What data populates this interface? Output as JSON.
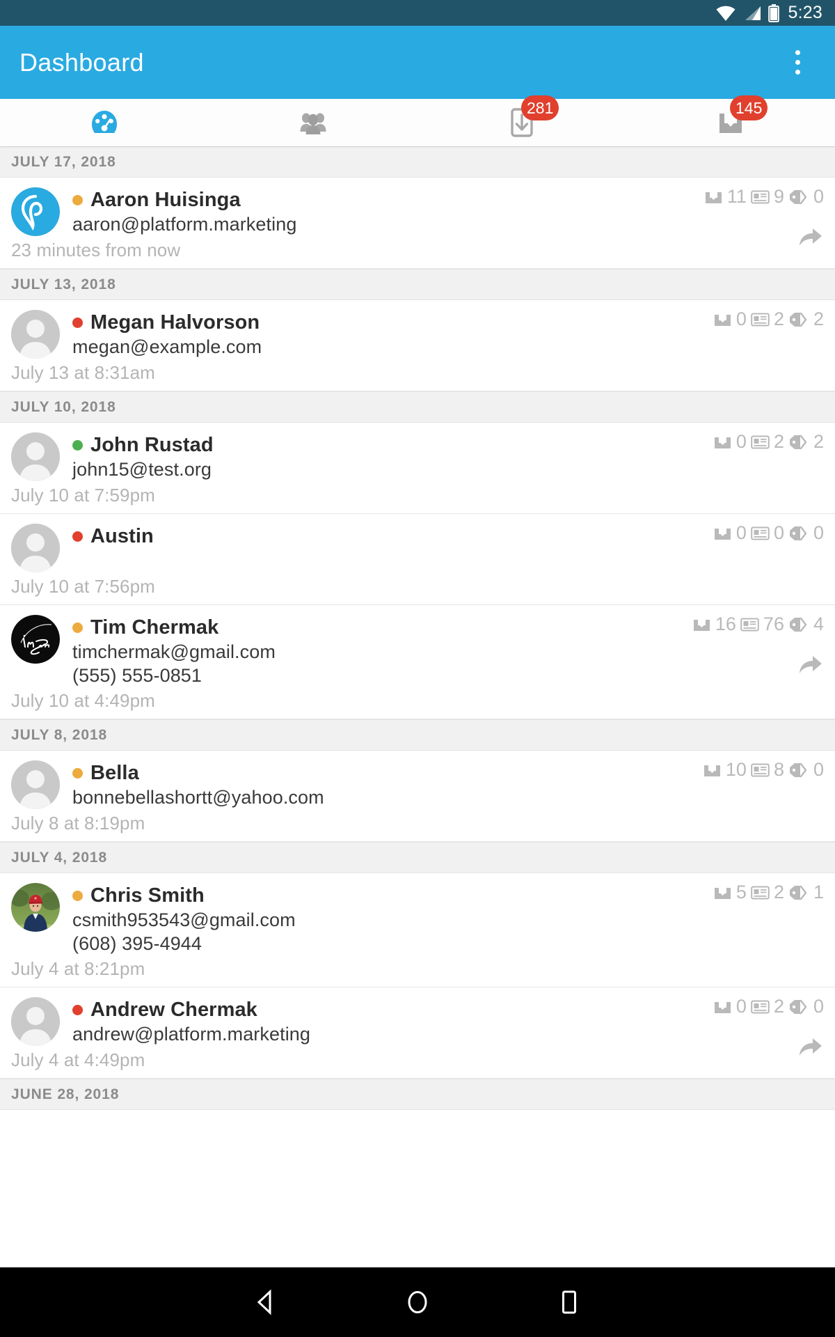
{
  "status_bar": {
    "time": "5:23",
    "icons": [
      "wifi-icon",
      "cell-signal-icon",
      "battery-icon"
    ]
  },
  "app_bar": {
    "title": "Dashboard",
    "overflow_label": "More options",
    "background": "#29aae1"
  },
  "tabs": [
    {
      "name": "dashboard",
      "icon": "speedometer-icon",
      "active": true,
      "badge": ""
    },
    {
      "name": "contacts",
      "icon": "people-icon",
      "active": false,
      "badge": ""
    },
    {
      "name": "tasks",
      "icon": "inbox-check-icon",
      "active": false,
      "badge": "281"
    },
    {
      "name": "inbox",
      "icon": "inbox-tray-icon",
      "active": false,
      "badge": "145"
    }
  ],
  "colors": {
    "accent": "#29aae1",
    "status_orange": "#edab3e",
    "status_red": "#e0402d",
    "status_green": "#4caf50",
    "badge_red": "#e0402d"
  },
  "sections": [
    {
      "date": "JULY 17, 2018",
      "rows": [
        {
          "name": "Aaron Huisinga",
          "email": "aaron@platform.marketing",
          "phone": "",
          "time": "23 minutes from now",
          "dot": "orange",
          "avatar": "logo-teardrop",
          "stats": {
            "inbox": "11",
            "notes": "9",
            "tags": "0"
          },
          "has_reply": true
        }
      ]
    },
    {
      "date": "JULY 13, 2018",
      "rows": [
        {
          "name": "Megan Halvorson",
          "email": "megan@example.com",
          "phone": "",
          "time": "July 13 at 8:31am",
          "dot": "red",
          "avatar": "placeholder",
          "stats": {
            "inbox": "0",
            "notes": "2",
            "tags": "2"
          },
          "has_reply": false
        }
      ]
    },
    {
      "date": "JULY 10, 2018",
      "rows": [
        {
          "name": "John Rustad",
          "email": "john15@test.org",
          "phone": "",
          "time": "July 10 at 7:59pm",
          "dot": "green",
          "avatar": "placeholder",
          "stats": {
            "inbox": "0",
            "notes": "2",
            "tags": "2"
          },
          "has_reply": false
        },
        {
          "name": "Austin",
          "email": "",
          "phone": "",
          "time": "July 10 at 7:56pm",
          "dot": "red",
          "avatar": "placeholder",
          "stats": {
            "inbox": "0",
            "notes": "0",
            "tags": "0"
          },
          "has_reply": false
        },
        {
          "name": "Tim Chermak",
          "email": "timchermak@gmail.com",
          "phone": "(555) 555-0851",
          "time": "July 10 at 4:49pm",
          "dot": "orange",
          "avatar": "signature-black",
          "stats": {
            "inbox": "16",
            "notes": "76",
            "tags": "4"
          },
          "has_reply": true
        }
      ]
    },
    {
      "date": "JULY 8, 2018",
      "rows": [
        {
          "name": "Bella",
          "email": "bonnebellashortt@yahoo.com",
          "phone": "",
          "time": "July 8 at 8:19pm",
          "dot": "orange",
          "avatar": "placeholder",
          "stats": {
            "inbox": "10",
            "notes": "8",
            "tags": "0"
          },
          "has_reply": false
        }
      ]
    },
    {
      "date": "JULY 4, 2018",
      "rows": [
        {
          "name": "Chris Smith",
          "email": "csmith953543@gmail.com",
          "phone": "(608) 395-4944",
          "time": "July 4 at 8:21pm",
          "dot": "orange",
          "avatar": "photo-person",
          "stats": {
            "inbox": "5",
            "notes": "2",
            "tags": "1"
          },
          "has_reply": false
        },
        {
          "name": "Andrew Chermak",
          "email": "andrew@platform.marketing",
          "phone": "",
          "time": "July 4 at 4:49pm",
          "dot": "red",
          "avatar": "placeholder",
          "stats": {
            "inbox": "0",
            "notes": "2",
            "tags": "0"
          },
          "has_reply": true
        }
      ]
    },
    {
      "date": "JUNE 28, 2018",
      "rows": []
    }
  ],
  "nav_bar": {
    "buttons": [
      "back-icon",
      "home-icon",
      "recents-icon"
    ]
  }
}
